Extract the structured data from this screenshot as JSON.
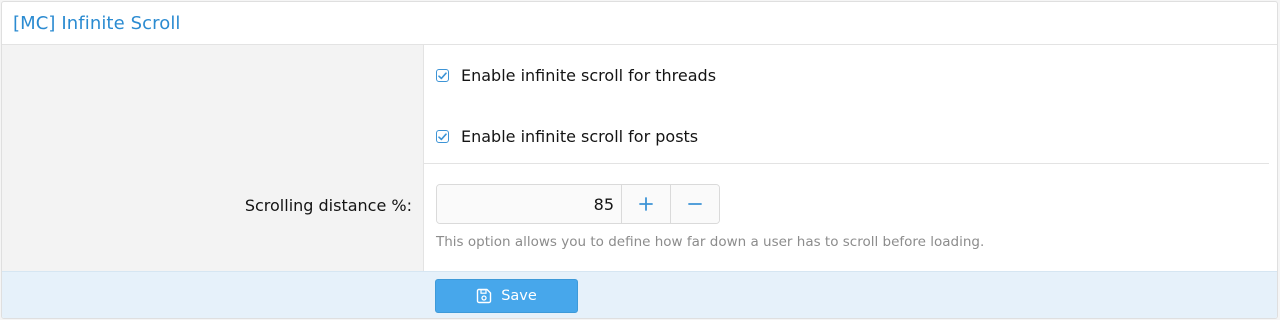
{
  "panel": {
    "title": "[MC] Infinite Scroll"
  },
  "options": [
    {
      "label": "Enable infinite scroll for threads",
      "checked": true
    },
    {
      "label": "Enable infinite scroll for posts",
      "checked": true
    }
  ],
  "scrolling": {
    "label": "Scrolling distance %:",
    "value": "85",
    "hint": "This option allows you to define how far down a user has to scroll before loading.",
    "increment_icon": "plus-icon",
    "decrement_icon": "minus-icon"
  },
  "footer": {
    "save_label": "Save",
    "save_icon": "save-icon"
  },
  "colors": {
    "accent": "#2b8bd1",
    "button": "#47a7eb",
    "footer_bg": "#e6f1fa"
  }
}
